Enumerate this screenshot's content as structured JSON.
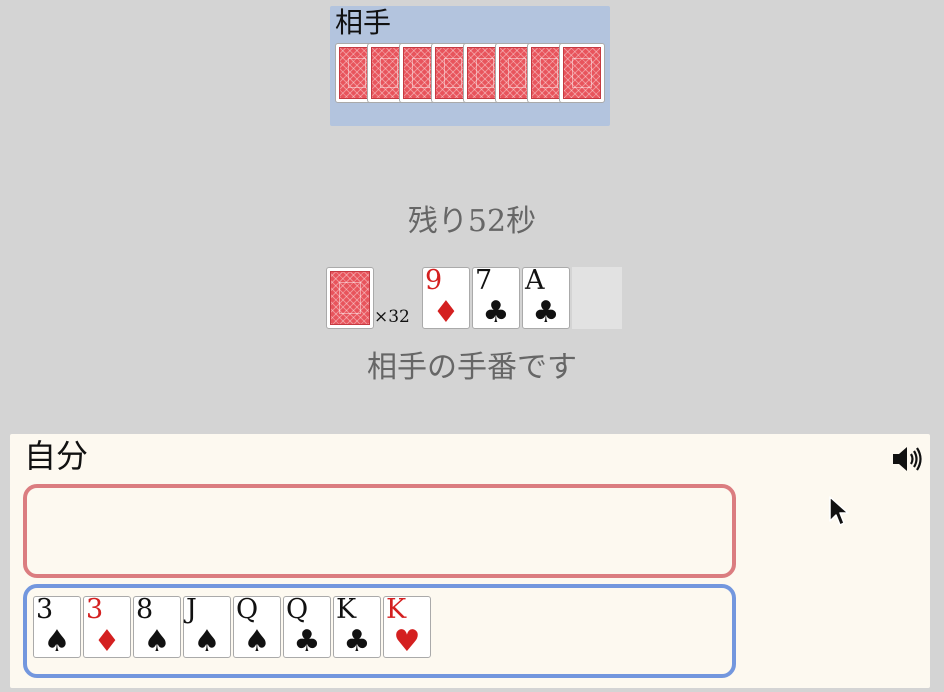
{
  "opponent": {
    "label": "相手",
    "hand_count": 8
  },
  "game": {
    "timer_text": "残り52秒",
    "deck_count": "×32",
    "turn_text": "相手の手番です"
  },
  "table_cards": [
    {
      "rank": "9",
      "suit": "♦",
      "color": "red"
    },
    {
      "rank": "7",
      "suit": "♣",
      "color": "black"
    },
    {
      "rank": "A",
      "suit": "♣",
      "color": "black"
    }
  ],
  "self": {
    "label": "自分",
    "play_area_cards": [],
    "hand": [
      {
        "rank": "3",
        "suit": "♠",
        "color": "black"
      },
      {
        "rank": "3",
        "suit": "♦",
        "color": "red"
      },
      {
        "rank": "8",
        "suit": "♠",
        "color": "black"
      },
      {
        "rank": "J",
        "suit": "♠",
        "color": "black"
      },
      {
        "rank": "Q",
        "suit": "♠",
        "color": "black"
      },
      {
        "rank": "Q",
        "suit": "♣",
        "color": "black"
      },
      {
        "rank": "K",
        "suit": "♣",
        "color": "black"
      },
      {
        "rank": "K",
        "suit": "♥",
        "color": "red"
      }
    ]
  },
  "icons": {
    "sound": "speaker-icon",
    "card_back": "card-back-icon",
    "pointer": "mouse-pointer-icon"
  },
  "colors": {
    "opponent_panel": "#b3c4de",
    "card_back": "#e8545c",
    "red_suit": "#d42020",
    "play_area_border": "#db7d80",
    "hand_area_border": "#7397de"
  }
}
